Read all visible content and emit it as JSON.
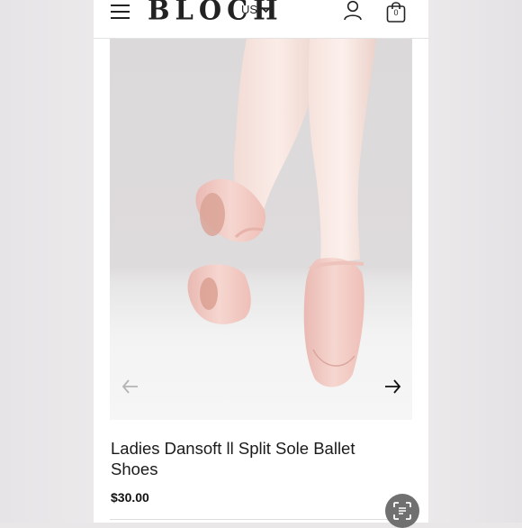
{
  "header": {
    "brand": "BLOCH",
    "region": "US",
    "cart_count": "0"
  },
  "product": {
    "title": "Ladies Dansoft ll Split Sole Ballet Shoes",
    "price": "$30.00"
  },
  "icons": {
    "menu": "hamburger-menu-icon",
    "region_toggle": "chevron-down-icon",
    "account": "user-icon",
    "cart": "shopping-bag-icon",
    "prev": "arrow-left-icon",
    "next": "arrow-right-icon",
    "visual_search": "lens-search-icon"
  },
  "colors": {
    "background": "#e9e7e8",
    "text": "#1a1a1a",
    "shoe_pink": "#f1c9c3"
  }
}
